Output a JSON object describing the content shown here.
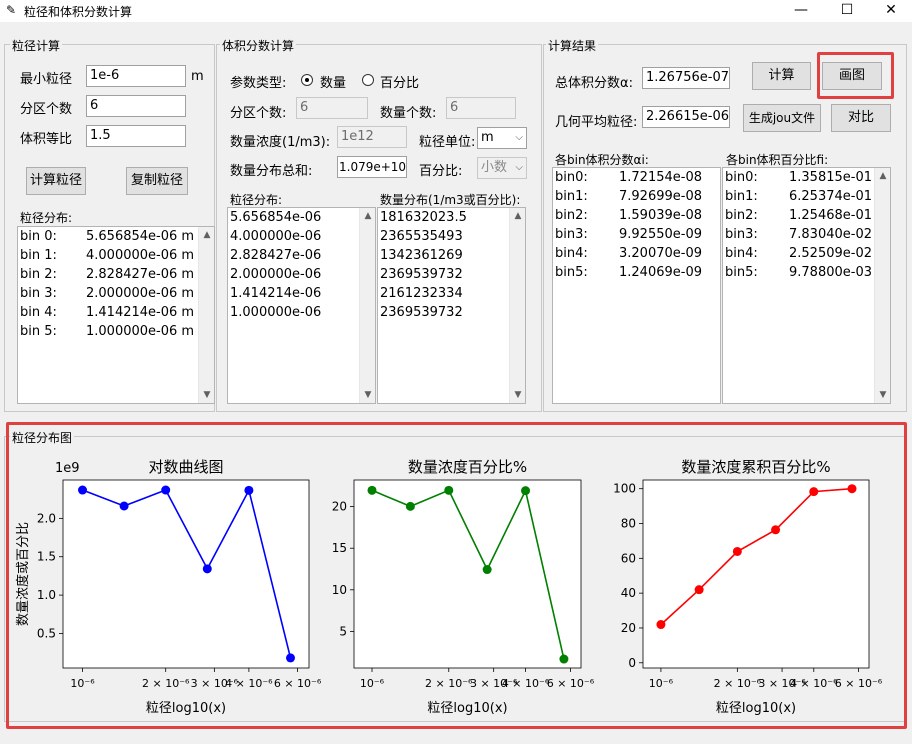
{
  "window": {
    "title": "粒径和体积分数计算",
    "minimize": "—",
    "maximize": "☐",
    "close": "✕"
  },
  "left": {
    "frame": "粒径计算",
    "min_label": "最小粒径",
    "min_value": "1e-6",
    "unit": "m",
    "part_label": "分区个数",
    "part_value": "6",
    "ratio_label": "体积等比",
    "ratio_value": "1.5",
    "calc_btn": "计算粒径",
    "copy_btn": "复制粒径",
    "dist_label": "粒径分布:",
    "rows": [
      {
        "bin": "bin 0:",
        "val": "5.656854e-06 m"
      },
      {
        "bin": "bin 1:",
        "val": "4.000000e-06 m"
      },
      {
        "bin": "bin 2:",
        "val": "2.828427e-06 m"
      },
      {
        "bin": "bin 3:",
        "val": "2.000000e-06 m"
      },
      {
        "bin": "bin 4:",
        "val": "1.414214e-06 m"
      },
      {
        "bin": "bin 5:",
        "val": "1.000000e-06 m"
      }
    ]
  },
  "mid": {
    "frame": "体积分数计算",
    "param_label": "参数类型:",
    "opt1": "数量",
    "opt2": "百分比",
    "part_label": "分区个数:",
    "part_value": "6",
    "count_label": "数量个数:",
    "count_value": "6",
    "conc_label": "数量浓度(1/m3):",
    "conc_value": "1e12",
    "unit_label": "粒径单位:",
    "unit_value": "m",
    "sum_label": "数量分布总和:",
    "sum_value": "1.079e+10",
    "pct_label": "百分比:",
    "pct_value": "小数",
    "size_label": "粒径分布:",
    "num_label": "数量分布(1/m3或百分比):",
    "sizes": [
      "5.656854e-06",
      "4.000000e-06",
      "2.828427e-06",
      "2.000000e-06",
      "1.414214e-06",
      "1.000000e-06"
    ],
    "nums": [
      "181632023.5",
      "2365535493",
      "1342361269",
      "2369539732",
      "2161232334",
      "2369539732"
    ]
  },
  "right": {
    "frame": "计算结果",
    "total_label": "总体积分数α:",
    "total_value": "1.26756e-07",
    "geo_label": "几何平均粒径:",
    "geo_value": "2.26615e-06",
    "calc_btn": "计算",
    "plot_btn": "画图",
    "jou_btn": "生成jou文件",
    "cmp_btn": "对比",
    "alpha_label": "各bin体积分数αi:",
    "pct_label": "各bin体积百分比fi:",
    "alphas": [
      {
        "bin": "bin0:",
        "val": "1.72154e-08"
      },
      {
        "bin": "bin1:",
        "val": "7.92699e-08"
      },
      {
        "bin": "bin2:",
        "val": "1.59039e-08"
      },
      {
        "bin": "bin3:",
        "val": "9.92550e-09"
      },
      {
        "bin": "bin4:",
        "val": "3.20070e-09"
      },
      {
        "bin": "bin5:",
        "val": "1.24069e-09"
      }
    ],
    "pcts": [
      {
        "bin": "bin0:",
        "val": "1.35815e-01"
      },
      {
        "bin": "bin1:",
        "val": "6.25374e-01"
      },
      {
        "bin": "bin2:",
        "val": "1.25468e-01"
      },
      {
        "bin": "bin3:",
        "val": "7.83040e-02"
      },
      {
        "bin": "bin4:",
        "val": "2.52509e-02"
      },
      {
        "bin": "bin5:",
        "val": "9.78800e-03"
      }
    ]
  },
  "plot_frame": "粒径分布图",
  "chart_data": [
    {
      "type": "line",
      "title": "对数曲线图",
      "xlabel": "粒径log10(x)",
      "ylabel": "数量浓度或百分比",
      "y_offset_text": "1e9",
      "xscale": "log",
      "xlim": [
        8.5e-07,
        6.6e-06
      ],
      "ylim": [
        0.05,
        2.5
      ],
      "color": "#0000ff",
      "x": [
        1e-06,
        1.414214e-06,
        2e-06,
        2.828427e-06,
        4e-06,
        5.656854e-06
      ],
      "y": [
        2.3695,
        2.1612,
        2.3695,
        1.3424,
        2.3655,
        0.1816
      ],
      "yticks": [
        {
          "v": 0.5,
          "t": "0.5"
        },
        {
          "v": 1.0,
          "t": "1.0"
        },
        {
          "v": 1.5,
          "t": "1.5"
        },
        {
          "v": 2.0,
          "t": "2.0"
        }
      ]
    },
    {
      "type": "line",
      "title": "数量浓度百分比%",
      "xlabel": "粒径log10(x)",
      "ylabel": "",
      "xscale": "log",
      "xlim": [
        8.5e-07,
        6.6e-06
      ],
      "ylim": [
        0.6,
        23.2
      ],
      "color": "#008000",
      "x": [
        1e-06,
        1.414214e-06,
        2e-06,
        2.828427e-06,
        4e-06,
        5.656854e-06
      ],
      "y": [
        21.96,
        20.03,
        21.96,
        12.44,
        21.92,
        1.68
      ],
      "yticks": [
        {
          "v": 5,
          "t": "5"
        },
        {
          "v": 10,
          "t": "10"
        },
        {
          "v": 15,
          "t": "15"
        },
        {
          "v": 20,
          "t": "20"
        }
      ]
    },
    {
      "type": "line",
      "title": "数量浓度累积百分比%",
      "xlabel": "粒径log10(x)",
      "ylabel": "",
      "xscale": "log",
      "xlim": [
        8.5e-07,
        6.6e-06
      ],
      "ylim": [
        -3,
        105
      ],
      "color": "#ff0000",
      "x": [
        1e-06,
        1.414214e-06,
        2e-06,
        2.828427e-06,
        4e-06,
        5.656854e-06
      ],
      "y": [
        21.96,
        41.99,
        63.95,
        76.39,
        98.32,
        100
      ],
      "yticks": [
        {
          "v": 0,
          "t": "0"
        },
        {
          "v": 20,
          "t": "20"
        },
        {
          "v": 40,
          "t": "40"
        },
        {
          "v": 60,
          "t": "60"
        },
        {
          "v": 80,
          "t": "80"
        },
        {
          "v": 100,
          "t": "100"
        }
      ]
    }
  ],
  "xticks": [
    {
      "v": 1e-06,
      "t": "10⁻⁶"
    },
    {
      "v": 2e-06,
      "t": "2 × 10⁻⁶"
    },
    {
      "v": 3e-06,
      "t": "3 × 10⁻⁶"
    },
    {
      "v": 4e-06,
      "t": "4 × 10⁻⁶"
    },
    {
      "v": 6e-06,
      "t": "6 × 10⁻⁶"
    }
  ]
}
